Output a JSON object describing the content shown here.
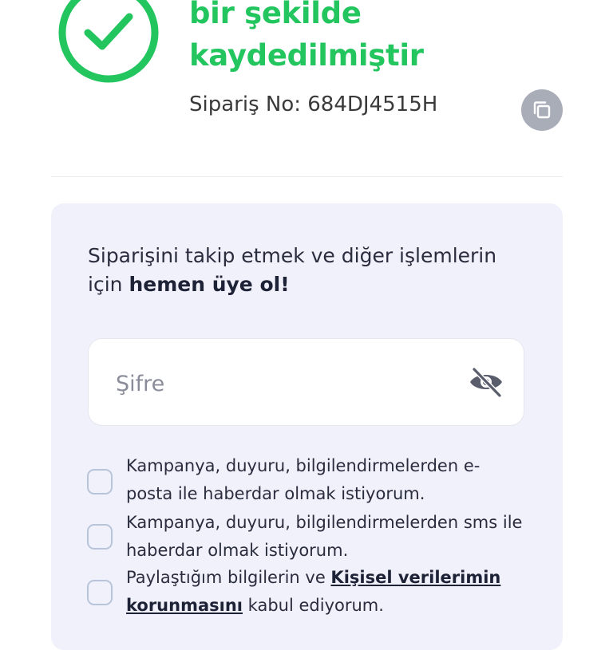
{
  "header": {
    "title_line1": "bir şekilde",
    "title_line2": "kaydedilmiştir",
    "order_label": "Sipariş No: 684DJ4515H"
  },
  "signup": {
    "prompt_text": "Siparişini takip etmek ve diğer işlemlerin için ",
    "prompt_bold": "hemen üye ol!",
    "password_placeholder": "Şifre",
    "consents": [
      {
        "text": "Kampanya, duyuru, bilgilendirmelerden e-posta ile haberdar olmak istiyorum."
      },
      {
        "text": "Kampanya, duyuru, bilgilendirmelerden sms ile haberdar olmak istiyorum."
      },
      {
        "text_before": "Paylaştığım bilgilerin ve ",
        "link": "Kişisel verilerimin korunmasını",
        "text_after": " kabul ediyorum."
      }
    ]
  },
  "colors": {
    "success": "#22c55e",
    "panel_bg": "#f1f1fb",
    "copy_button": "#a9adb8"
  },
  "icons": {
    "success": "check-circle-icon",
    "copy": "copy-icon",
    "password_toggle": "eye-off-icon"
  }
}
